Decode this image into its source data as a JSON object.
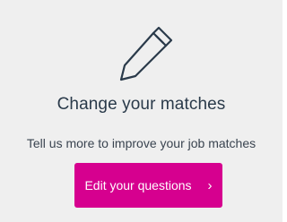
{
  "card": {
    "icon": "pencil-icon",
    "title": "Change your matches",
    "subtitle": "Tell us more to improve your job matches",
    "button_label": "Edit your questions",
    "button_chevron": "›",
    "button_color": "#d6008f",
    "background_color": "#efefef"
  }
}
